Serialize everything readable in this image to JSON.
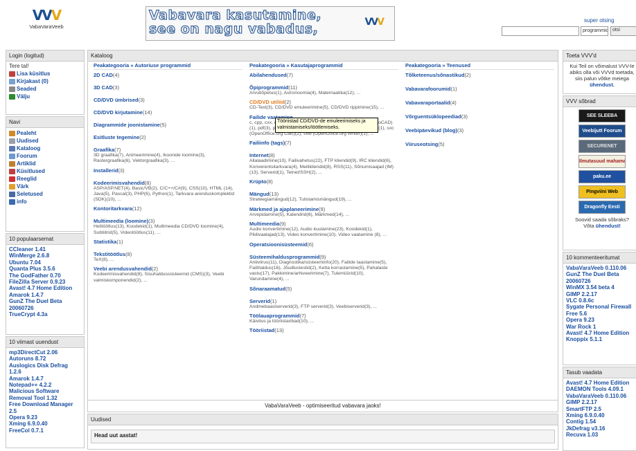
{
  "header": {
    "logo_mark_a": "VV",
    "logo_mark_b": "V",
    "logo_name": "VabaVaraVeeb",
    "banner_line1": "Vabavara kasutamine,",
    "banner_line2": "see on nagu vabadus,",
    "search_label": "super otsing",
    "search_input_value": "",
    "search_select_value": "programmid",
    "search_button": "otsi"
  },
  "login": {
    "title": "Login (logitud)",
    "greeting": "Tere tal!",
    "items": [
      {
        "label": "Lisa küsitlus",
        "icon": "chart-icon",
        "color": "#c04040"
      },
      {
        "label": "Kirjakast (0)",
        "icon": "mail-icon",
        "color": "#7aa0d0"
      },
      {
        "label": "Seaded",
        "icon": "wrench-icon",
        "color": "#888888"
      },
      {
        "label": "Välju",
        "icon": "exit-icon",
        "color": "#2e8b2e"
      }
    ]
  },
  "navi": {
    "title": "Navi",
    "items": [
      {
        "label": "Pealeht",
        "icon": "home-icon",
        "color": "#d08a2a"
      },
      {
        "label": "Uudised",
        "icon": "news-icon",
        "color": "#9aa0a8"
      },
      {
        "label": "Kataloog",
        "icon": "catalog-icon",
        "color": "#5a7ab0"
      },
      {
        "label": "Foorum",
        "icon": "forum-icon",
        "color": "#6a9ad0"
      },
      {
        "label": "Artiklid",
        "icon": "article-icon",
        "color": "#c08030"
      },
      {
        "label": "Küsitlused",
        "icon": "poll-icon",
        "color": "#c04040"
      },
      {
        "label": "Reeglid",
        "icon": "rules-icon",
        "color": "#d03030"
      },
      {
        "label": "Värk",
        "icon": "stuff-icon",
        "color": "#e0a030"
      },
      {
        "label": "Seletused",
        "icon": "help-icon",
        "color": "#4a6aa0"
      },
      {
        "label": "info",
        "icon": "info-icon",
        "color": "#3a6ab0"
      }
    ]
  },
  "popular": {
    "title": "10 populaarsemat",
    "items": [
      "CCleaner 1.41",
      "WinMerge 2.6.8",
      "Ubuntu 7.04",
      "Quanta Plus 3.5.6",
      "The GodFather 0.70",
      "FileZilla Server 0.9.23",
      "Avast! 4.7 Home Edition",
      "Amarok 1.4.7",
      "GunZ The Duel Beta 20060726",
      "TrueCrypt 4.3a"
    ]
  },
  "updates": {
    "title": "10 viimast uuendust",
    "items": [
      "mp3DirectCut 2.06",
      "Autoruns 8.72",
      "Auslogics Disk Defrag 1.2.6",
      "Amarok 1.4.7",
      "Notepad++ 4.2.2",
      "Malicious Software Removal Tool 1.32",
      "Free Download Manager 2.5",
      "Opera 9.23",
      "Xming 6.9.0.40",
      "FreeCol 0.7.1"
    ]
  },
  "catalog": {
    "title": "Kataloog",
    "footer": "VabaVaraVeeb - optimiseeritud vabavara jaoks!",
    "tooltip": "Tööriistad CD/DVD-de emuleerimiseks ja valmistamiseks/töötlemiseks.",
    "columns": [
      {
        "crumb_root": "Peakategooria",
        "crumb_name": "Autoriuse programmid",
        "cats": [
          {
            "t": "2D CAD",
            "n": "(4)",
            "s": ""
          },
          {
            "t": "3D CAD",
            "n": "(3)",
            "s": ""
          },
          {
            "t": "CD/DVD ümbrised",
            "n": "(3)",
            "s": ""
          },
          {
            "t": "CD/DVD kirjutamine",
            "n": "(14)",
            "s": ""
          },
          {
            "t": "Diagrammide joonistamine",
            "n": "(5)",
            "s": ""
          },
          {
            "t": "Esitluste tegemine",
            "n": "(2)",
            "s": ""
          },
          {
            "t": "Graafika",
            "n": "(7)",
            "s": "3D graafika(7), Animeerimine(4), Ikoonide loomine(3), Rastergraafika(6), Vektorgraafika(3), ..."
          },
          {
            "t": "Installerid",
            "n": "(3)",
            "s": ""
          },
          {
            "t": "Kodeerimisvahendid",
            "n": "(8)",
            "s": "ASP/ASP.NET(4), Basic/VB(2), C/C++/C#(9), CSS(10), HTML (14), Java(5), Pascal(3), PHP(6), Python(1), Tarkvara arenduskomplektid (SDK)(10), ..."
          },
          {
            "t": "Kontoritarkvara",
            "n": "(12)",
            "s": ""
          },
          {
            "t": "Multimeedia (loomine)",
            "n": "(3)",
            "s": "Helitöötlus(13), Koodekid(1), Multimeedia CD/DVD loomine(4), Subtiitrid(5), Videotöötlus(11), ..."
          },
          {
            "t": "Statistika",
            "n": "(1)",
            "s": ""
          },
          {
            "t": "Tekstitöötlus",
            "n": "(8)",
            "s": "TeX(8), ..."
          },
          {
            "t": "Veebi arendusvahendid",
            "n": "(2)",
            "s": "Kodeerimisvahendid(8), Sisuhaldussüsteemid (CMS)(3), Veebi valmiskomponendid(2), ..."
          }
        ]
      },
      {
        "crumb_root": "Peakategooria",
        "crumb_name": "Kasutajaprogrammid",
        "cats": [
          {
            "t": "Abilahendused",
            "n": "(7)",
            "s": ""
          },
          {
            "t": "Õpiprogrammid",
            "n": "(11)",
            "s": "Arvutiõpetus(1), Astronoomia(4), Matemaatika(12), ..."
          },
          {
            "t": "CD/DVD utiliid",
            "n": "(2)",
            "s": "CD-Text(3), CD/DVD emuleerimine(5), CD/DVD rippimine(15), ...",
            "hot": true
          },
          {
            "t": "Failide vaatamine",
            "n": "",
            "s": "c, cpp, cxx, cc, h, hpp, hxx(2), doc, dot (MS Word)(3), dxf (AutoCAD)(1), pdf(3), ppt, pps, pot (MS PowerPoint)(2), ps (0), rtf(3), svg(1), sxc (OpenOffice.org Calc)(2), sxw (OpenOffice.org Writer)(1), ..."
          },
          {
            "t": "Failiinfo (tags)",
            "n": "(7)",
            "s": ""
          },
          {
            "t": "Internet",
            "n": "(8)",
            "s": "Allalaadimine(10), Failivahetus(22), FTP kliendid(9), IRC kliendid(6), Konverentsitarkvara(4), Meilikliendid(8), RSS(11), Sõnumisaajad (IM)(13), Serverid(1), Telnet/SSH(2), ..."
          },
          {
            "t": "Krüpto",
            "n": "(8)",
            "s": ""
          },
          {
            "t": "Mängud",
            "n": "(13)",
            "s": "Strateegiamängud(12), Tulistamismängud(19), ..."
          },
          {
            "t": "Märkmed ja ajaplaneerimine",
            "n": "(9)",
            "s": "Arvepidamine(5), Kalendrid(6), Märkmed(14), ..."
          },
          {
            "t": "Multimeedia",
            "n": "(9)",
            "s": "Audio konvertimine(12), Audio kuulamine(23), Koodekid(1), Pildivaatajad(13), Video konvertimine(10), Video vaatamine (8), ..."
          },
          {
            "t": "Operatsioonisüsteemid",
            "n": "(6)",
            "s": ""
          },
          {
            "t": "Süsteemihaldusprogrammid",
            "n": "(9)",
            "s": "Antiviirus(11), Diagnostika/süsteeminfo(20), Failide taastamine(5), Failihaldus(16), Jõudlustestid(2), Ketta korrastamine(5), Pahalaste vastu(17), Pakkimine/arhiveerimine(7), Tulemüürid(10), Varundamine(4), ..."
          },
          {
            "t": "Sõnaraamatud",
            "n": "(5)",
            "s": ""
          },
          {
            "t": "Serverid",
            "n": "(1)",
            "s": "Andmebaasiserverid(3), FTP serverid(3), Veebiserverid(3), ..."
          },
          {
            "t": "Töölauaprogrammid",
            "n": "(7)",
            "s": "Käivitus ja tööriistaribad(10), ..."
          },
          {
            "t": "Tööriistad",
            "n": "(13)",
            "s": ""
          }
        ]
      },
      {
        "crumb_root": "Peakategooria",
        "crumb_name": "Teenused",
        "cats": [
          {
            "t": "Tõlketeenus/sõnastikud",
            "n": "(2)",
            "s": ""
          },
          {
            "t": "Vabavarafoorumid",
            "n": "(1)",
            "s": ""
          },
          {
            "t": "Vabavaraportaalid",
            "n": "(4)",
            "s": ""
          },
          {
            "t": "Võrguentsüklopeediad",
            "n": "(3)",
            "s": ""
          },
          {
            "t": "Veebipäevikud (blog)",
            "n": "(3)",
            "s": ""
          },
          {
            "t": "Viiruseotsing",
            "n": "(5)",
            "s": ""
          }
        ]
      }
    ]
  },
  "news": {
    "title": "Uudised",
    "first_title": "Head uut aastat!"
  },
  "right": {
    "support_title": "Toeta VVV'd",
    "support_text": "Kui Teil on võimalust VVV-le abiks olla või VVVd toetada, siis palun võtke meiega",
    "support_link": "ühendust.",
    "friends_title": "VVV sõbrad",
    "friends": [
      {
        "label": "SEE SLEEBA",
        "bg": "#1a1a1a",
        "fg": "#f0f0f0"
      },
      {
        "label": "Veebijutt Foorum",
        "bg": "#1f4d8c",
        "fg": "#ffffff"
      },
      {
        "label": "SECURENET",
        "bg": "#5a6a7a",
        "fg": "#e0e0e0"
      },
      {
        "label": "Ilmutasuud mahamange",
        "bg": "#f4f0e0",
        "fg": "#a02020"
      },
      {
        "label": "paku.ee",
        "bg": "#2050a0",
        "fg": "#ffffff"
      },
      {
        "label": "Pingviini Web",
        "bg": "#f0c020",
        "fg": "#000000"
      },
      {
        "label": "Dragonfly Eesti",
        "bg": "#2a6ab0",
        "fg": "#ffffff"
      }
    ],
    "friends_text": "Soovid saada sõbraks?",
    "friends_link_pre": "Võta",
    "friends_link": "ühendust!",
    "commented_title": "10 kommenteeritumat",
    "commented": [
      "VabaVaraVeeb 0.110.06",
      "GunZ The Duel Beta 20060726",
      "WinMX 3.54 beta 4",
      "GIMP 2.2.17",
      "VLC 0.8.6c",
      "Sygate Personal Firewall Free 5.6",
      "Opera 9.23",
      "War Rock 1",
      "Avast! 4.7 Home Edition",
      "Knoppix 5.1.1"
    ],
    "see_title": "Tasub vaadata",
    "see": [
      "Avast! 4.7 Home Edition",
      "DAEMON Tools 4.09.1",
      "VabaVaraVeeb 0.110.06",
      "GIMP 2.2.17",
      "SmartFTP 2.5",
      "Xming 6.9.0.40",
      "Contig 1.54",
      "JkDefrag v3.16",
      "Recuva 1.03"
    ]
  }
}
